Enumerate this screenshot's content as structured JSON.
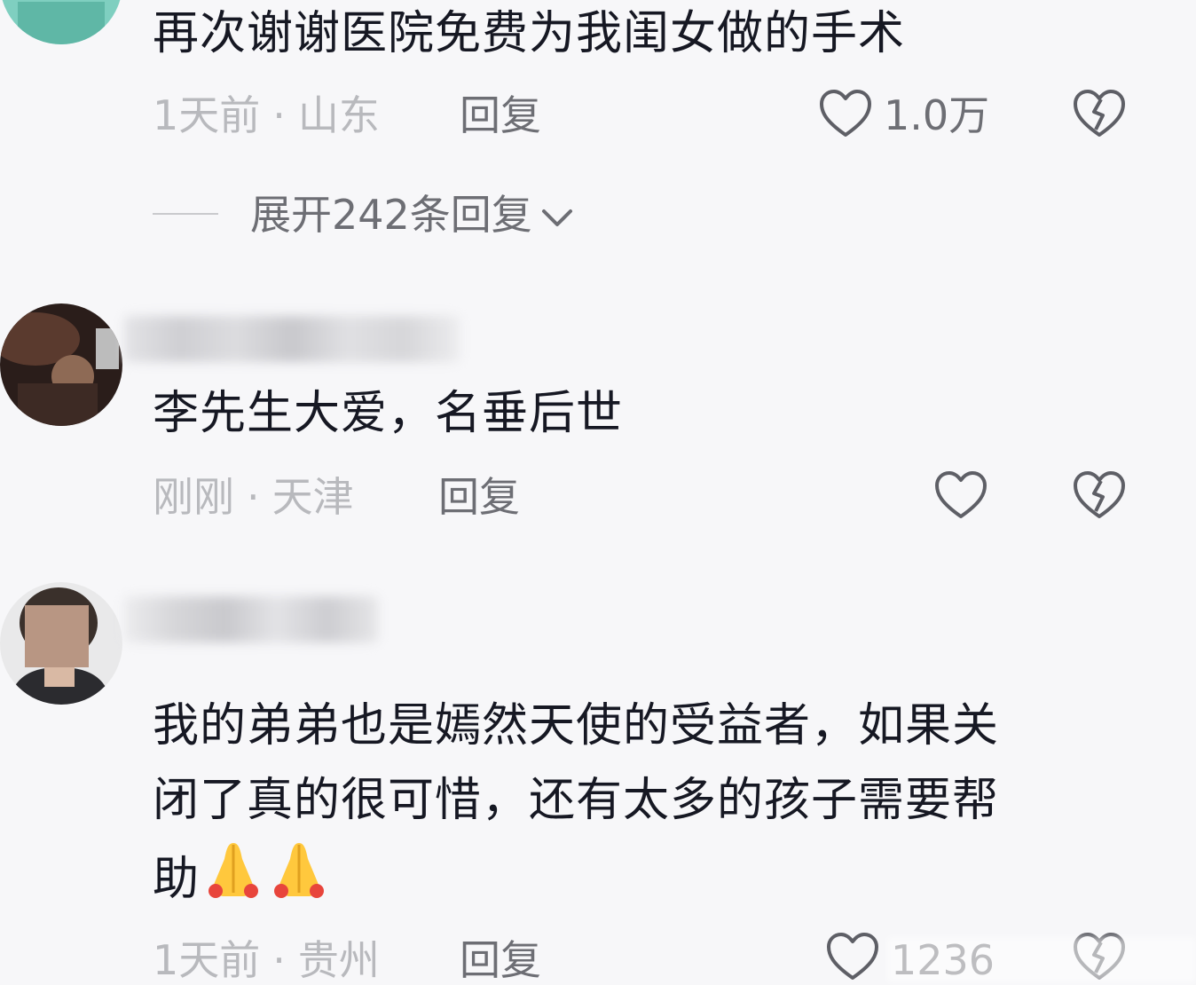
{
  "comments": [
    {
      "text": "再次谢谢医院免费为我闺女做的手术",
      "time": "1天前",
      "location": "山东",
      "reply_label": "回复",
      "likes": "1.0万",
      "expand_label": "展开242条回复"
    },
    {
      "text": "李先生大爱，名垂后世",
      "time": "刚刚",
      "location": "天津",
      "reply_label": "回复",
      "likes": ""
    },
    {
      "text_line1": "我的弟弟也是嫣然天使的受益者，如果关",
      "text_line2": "闭了真的很可惜，还有太多的孩子需要帮",
      "text_line3": "助",
      "emoji": "folded-hands",
      "time": "1天前",
      "location": "贵州",
      "reply_label": "回复",
      "likes": "1236"
    }
  ],
  "separator": "·",
  "icons": {
    "like": "heart-outline-icon",
    "dislike": "broken-heart-icon",
    "expand": "chevron-down-icon"
  },
  "colors": {
    "background": "#f7f7f9",
    "text_primary": "#161823",
    "text_meta": "#b8b9bd",
    "text_action": "#6d6e74"
  }
}
